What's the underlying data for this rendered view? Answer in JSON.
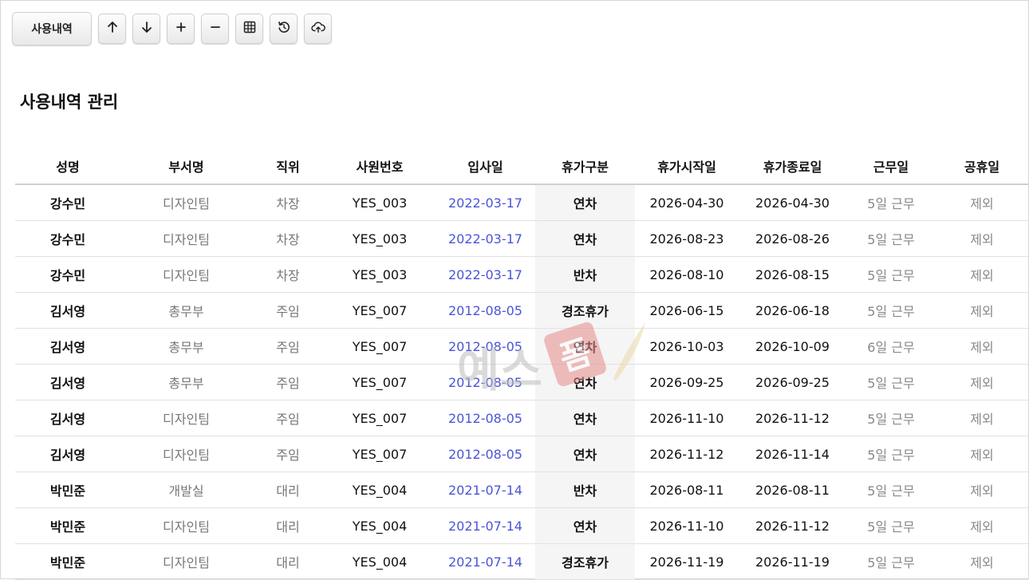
{
  "toolbar": {
    "history_label": "사용내역",
    "icons": [
      "arrow-up-icon",
      "arrow-down-icon",
      "plus-icon",
      "minus-icon",
      "grid-icon",
      "refresh-icon",
      "cloud-upload-icon"
    ]
  },
  "page_title": "사용내역 관리",
  "table": {
    "headers": [
      "성명",
      "부서명",
      "직위",
      "사원번호",
      "입사일",
      "휴가구분",
      "휴가시작일",
      "휴가종료일",
      "근무일",
      "공휴일"
    ],
    "rows": [
      [
        "강수민",
        "디자인팀",
        "차장",
        "YES_003",
        "2022-03-17",
        "연차",
        "2026-04-30",
        "2026-04-30",
        "5일 근무",
        "제외"
      ],
      [
        "강수민",
        "디자인팀",
        "차장",
        "YES_003",
        "2022-03-17",
        "연차",
        "2026-08-23",
        "2026-08-26",
        "5일 근무",
        "제외"
      ],
      [
        "강수민",
        "디자인팀",
        "차장",
        "YES_003",
        "2022-03-17",
        "반차",
        "2026-08-10",
        "2026-08-15",
        "5일 근무",
        "제외"
      ],
      [
        "김서영",
        "총무부",
        "주임",
        "YES_007",
        "2012-08-05",
        "경조휴가",
        "2026-06-15",
        "2026-06-18",
        "5일 근무",
        "제외"
      ],
      [
        "김서영",
        "총무부",
        "주임",
        "YES_007",
        "2012-08-05",
        "연차",
        "2026-10-03",
        "2026-10-09",
        "6일 근무",
        "제외"
      ],
      [
        "김서영",
        "총무부",
        "주임",
        "YES_007",
        "2012-08-05",
        "연차",
        "2026-09-25",
        "2026-09-25",
        "5일 근무",
        "제외"
      ],
      [
        "김서영",
        "디자인팀",
        "주임",
        "YES_007",
        "2012-08-05",
        "연차",
        "2026-11-10",
        "2026-11-12",
        "5일 근무",
        "제외"
      ],
      [
        "김서영",
        "디자인팀",
        "주임",
        "YES_007",
        "2012-08-05",
        "연차",
        "2026-11-12",
        "2026-11-14",
        "5일 근무",
        "제외"
      ],
      [
        "박민준",
        "개발실",
        "대리",
        "YES_004",
        "2021-07-14",
        "반차",
        "2026-08-11",
        "2026-08-11",
        "5일 근무",
        "제외"
      ],
      [
        "박민준",
        "디자인팀",
        "대리",
        "YES_004",
        "2021-07-14",
        "연차",
        "2026-11-10",
        "2026-11-12",
        "5일 근무",
        "제외"
      ],
      [
        "박민준",
        "디자인팀",
        "대리",
        "YES_004",
        "2021-07-14",
        "경조휴가",
        "2026-11-19",
        "2026-11-19",
        "5일 근무",
        "제외"
      ]
    ]
  },
  "watermark": {
    "text": "예스",
    "stamp": "폼"
  },
  "colors": {
    "hire_date": "#4a55d6",
    "type_column_bg": "#f5f5f5"
  }
}
